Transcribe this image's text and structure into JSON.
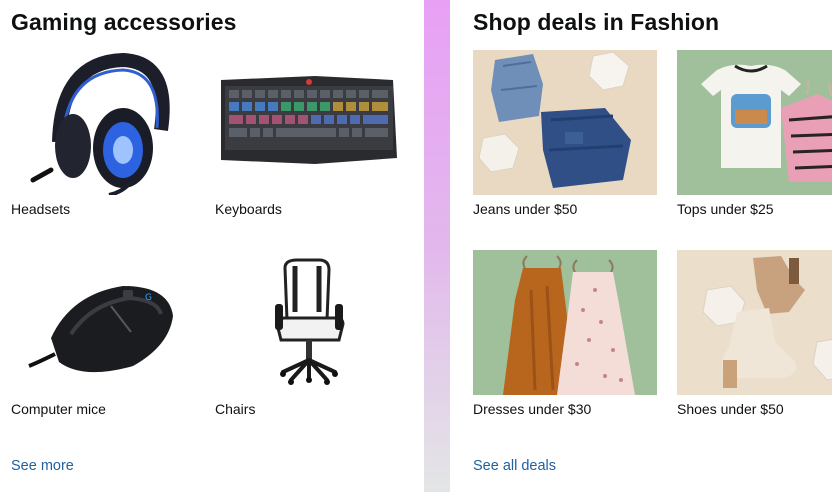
{
  "left_card": {
    "title": "Gaming accessories",
    "tiles": [
      {
        "label": "Headsets",
        "icon": "headset-image"
      },
      {
        "label": "Keyboards",
        "icon": "keyboard-image"
      },
      {
        "label": "Computer mice",
        "icon": "mouse-image"
      },
      {
        "label": "Chairs",
        "icon": "chair-image"
      }
    ],
    "link": "See more"
  },
  "right_card": {
    "title": "Shop deals in Fashion",
    "tiles": [
      {
        "label": "Jeans under $50",
        "icon": "jeans-image"
      },
      {
        "label": "Tops under $25",
        "icon": "tops-image"
      },
      {
        "label": "Dresses under $30",
        "icon": "dresses-image"
      },
      {
        "label": "Shoes under $50",
        "icon": "shoes-image"
      }
    ],
    "link": "See all deals"
  },
  "colors": {
    "link": "#2162a1",
    "text": "#0f1111",
    "background_top": "#e8a0f5",
    "background_bottom": "#e3e6e6"
  }
}
